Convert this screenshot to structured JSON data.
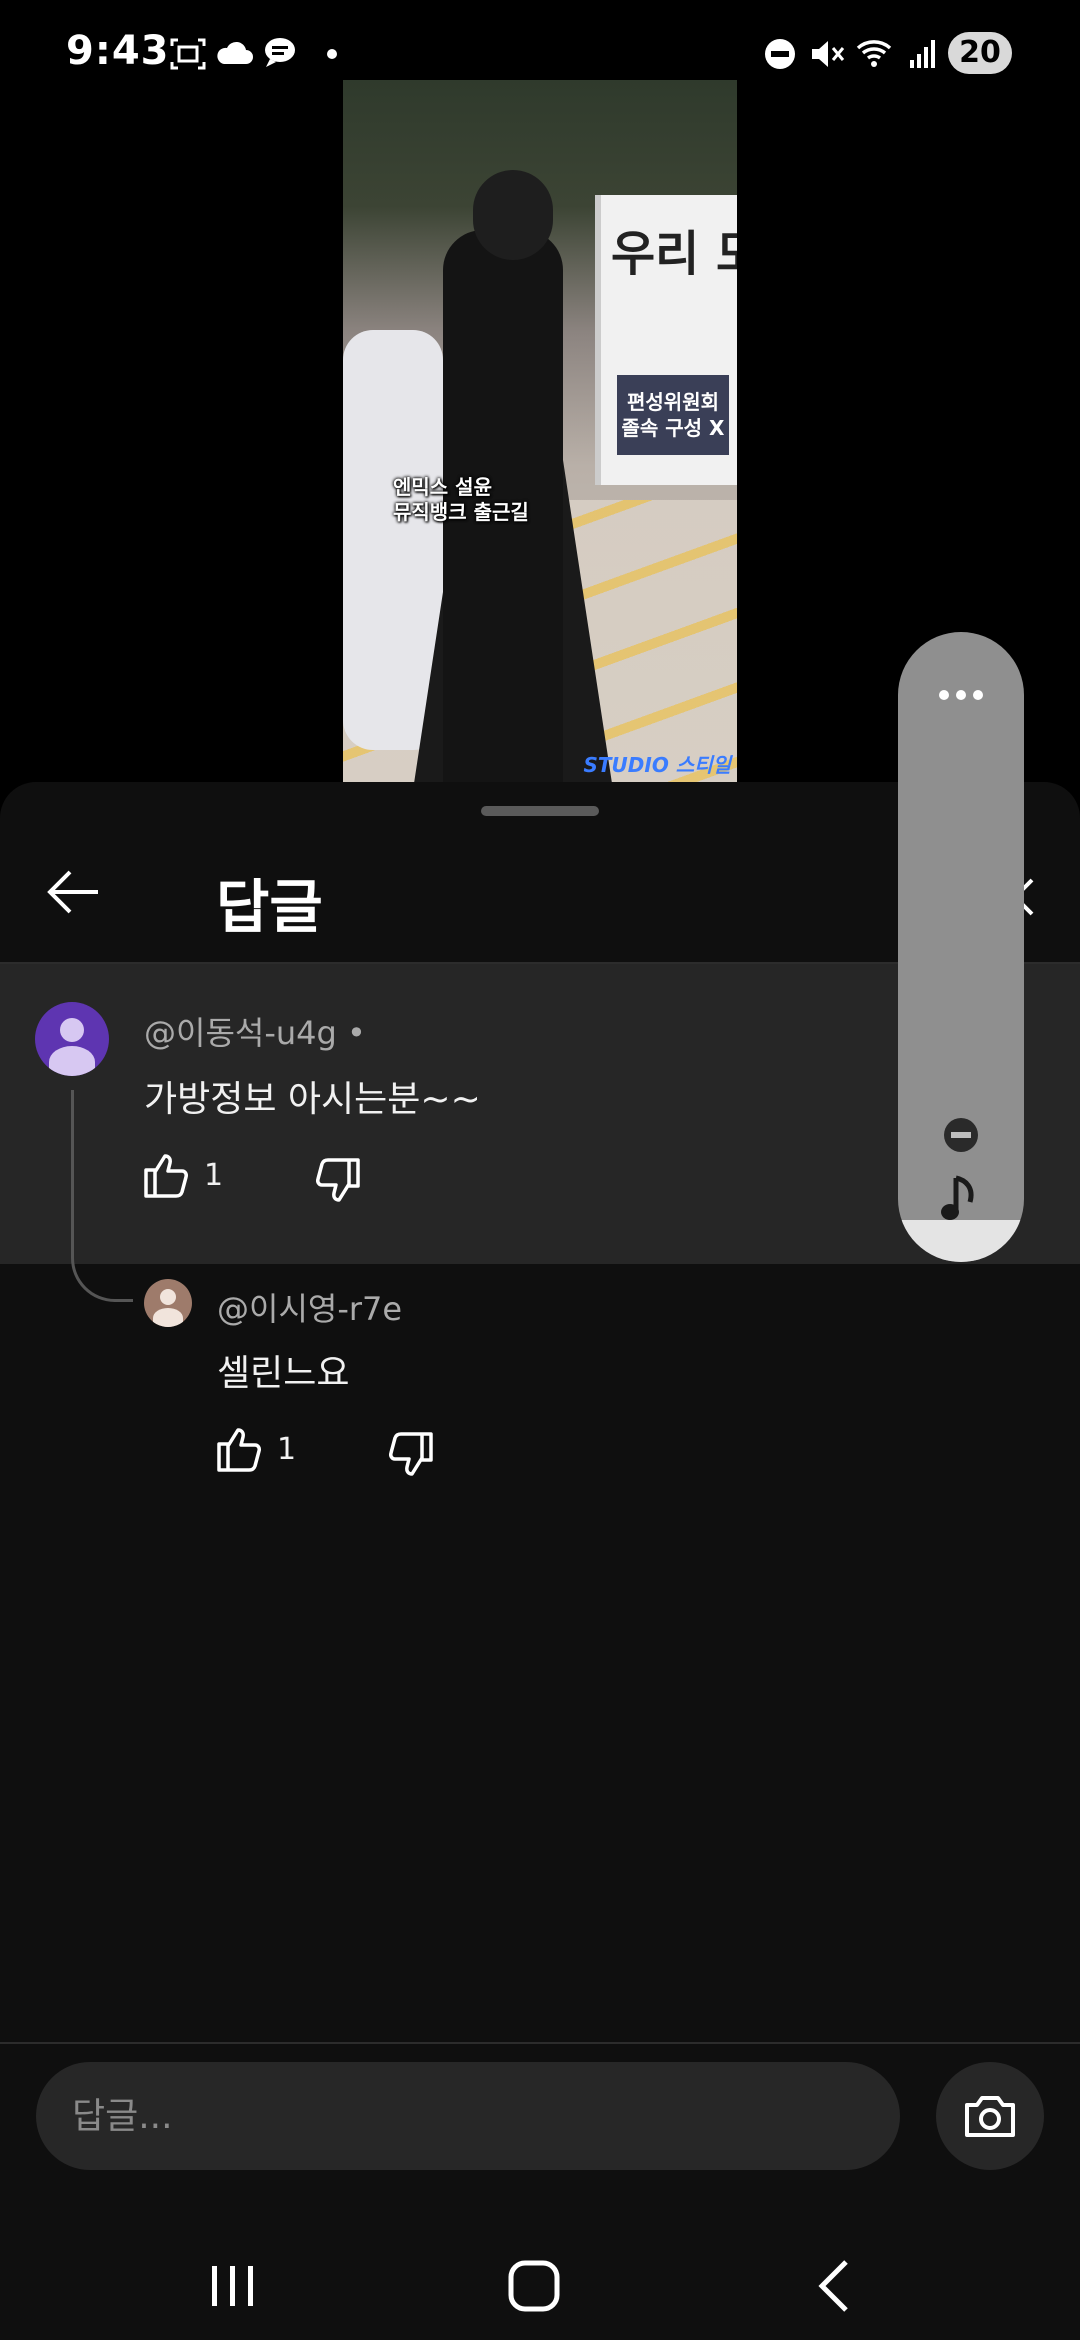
{
  "status_bar": {
    "time": "9:43",
    "battery": "20",
    "icons": [
      "screenshot-icon",
      "cloud-icon",
      "chat-icon",
      "dot-icon",
      "dnd-icon",
      "mute-icon",
      "wifi-icon",
      "signal-icon"
    ]
  },
  "video": {
    "caption_line1": "엔믹스 설윤",
    "caption_line2": "뮤직뱅크 출근길",
    "banner_text": "우리 모두가",
    "banner_sub": "편성위원회\n졸속 구성 X",
    "watermark": "STUDIO 스티일"
  },
  "header": {
    "title": "답글"
  },
  "parent_comment": {
    "author": "@이동석-u4g •",
    "text": "가방정보 아시는분~~",
    "likes": "1"
  },
  "reply": {
    "author": "@이시영-r7e",
    "text": "셀린느요",
    "likes": "1"
  },
  "reply_box": {
    "placeholder": "답글..."
  },
  "colors": {
    "sheet_bg": "#0f0f0f",
    "highlight_bg": "#262626",
    "avatar_purple": "#5e35b1",
    "avatar_brown": "#9e7b6b",
    "floating_panel": "#8f8f8f"
  }
}
